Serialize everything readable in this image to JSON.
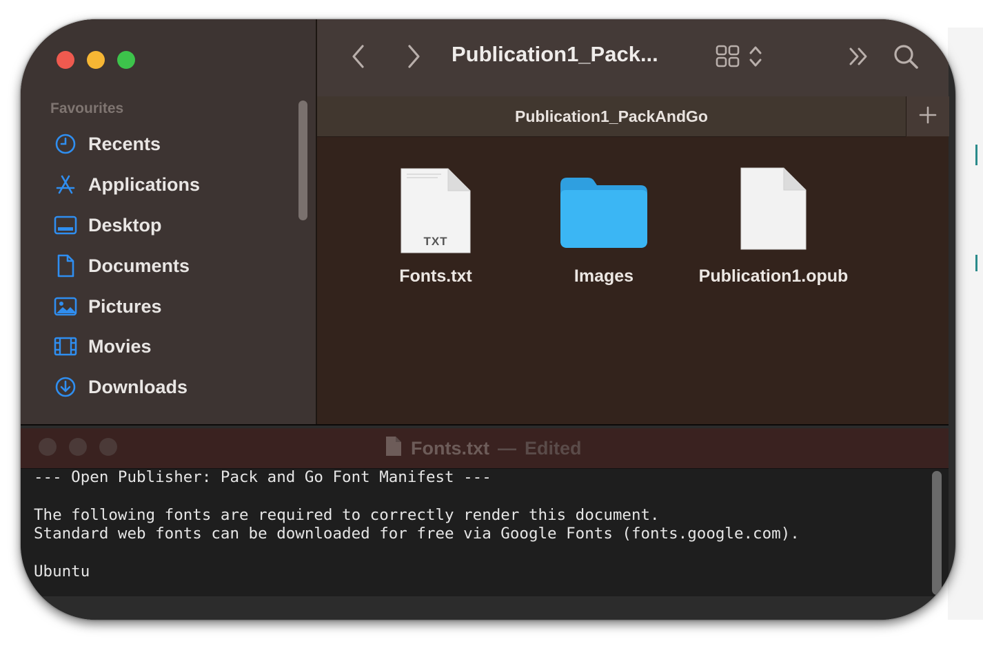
{
  "finder": {
    "sidebar": {
      "section_title": "Favourites",
      "items": [
        {
          "label": "Recents",
          "icon": "clock-icon"
        },
        {
          "label": "Applications",
          "icon": "applications-icon"
        },
        {
          "label": "Desktop",
          "icon": "desktop-icon"
        },
        {
          "label": "Documents",
          "icon": "document-icon"
        },
        {
          "label": "Pictures",
          "icon": "pictures-icon"
        },
        {
          "label": "Movies",
          "icon": "film-icon"
        },
        {
          "label": "Downloads",
          "icon": "download-icon"
        }
      ]
    },
    "toolbar": {
      "title": "Publication1_Pack..."
    },
    "path_tab": "Publication1_PackAndGo",
    "files": [
      {
        "name": "Fonts.txt",
        "type": "text-file",
        "badge": "TXT"
      },
      {
        "name": "Images",
        "type": "folder"
      },
      {
        "name": "Publication1.opub",
        "type": "generic-file"
      }
    ],
    "colors": {
      "accent_blue": "#2f8ef0",
      "folder_blue": "#38b3f2"
    }
  },
  "textedit": {
    "title": "Fonts.txt",
    "separator": "—",
    "status": "Edited",
    "lines": [
      "--- Open Publisher: Pack and Go Font Manifest ---",
      "",
      "The following fonts are required to correctly render this document.",
      "Standard web fonts can be downloaded for free via Google Fonts (fonts.google.com).",
      "",
      "Ubuntu"
    ]
  }
}
